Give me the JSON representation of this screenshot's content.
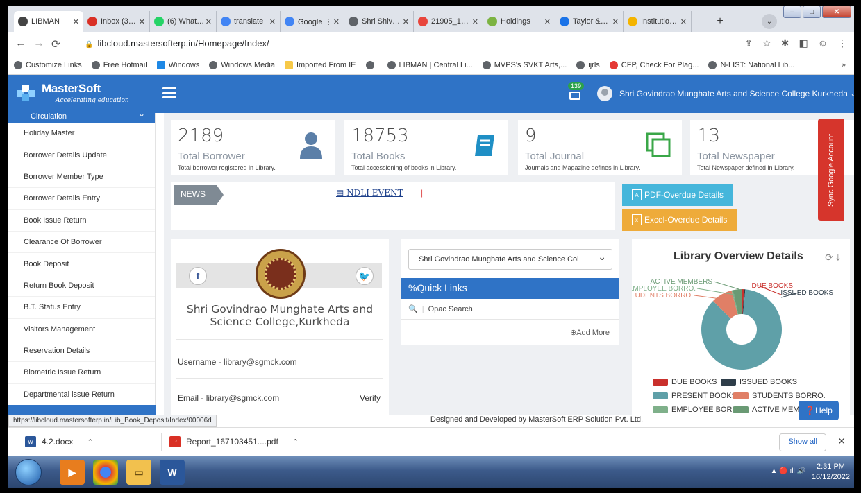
{
  "browser": {
    "tabs": [
      {
        "label": "LIBMAN",
        "color": "#444444",
        "active": true
      },
      {
        "label": "Inbox (3…",
        "color": "#d93025"
      },
      {
        "label": "(6) What…",
        "color": "#25d366"
      },
      {
        "label": "translate",
        "color": "#4285f4"
      },
      {
        "label": "Google ⋮",
        "color": "#4285f4"
      },
      {
        "label": "Shri Shiv…",
        "color": "#5f6368"
      },
      {
        "label": "21905_1…",
        "color": "#e8453c"
      },
      {
        "label": "Holdings",
        "color": "#7cb342"
      },
      {
        "label": "Taylor &…",
        "color": "#1a73e8"
      },
      {
        "label": "Institutio…",
        "color": "#f4b400"
      }
    ],
    "url": "libcloud.mastersofterp.in/Homepage/Index/",
    "bookmarks": [
      {
        "label": "Customize Links",
        "type": "globe"
      },
      {
        "label": "Free Hotmail",
        "type": "globe"
      },
      {
        "label": "Windows",
        "type": "win"
      },
      {
        "label": "Windows Media",
        "type": "globe"
      },
      {
        "label": "Imported From IE",
        "type": "folder"
      },
      {
        "label": "",
        "type": "globe"
      },
      {
        "label": "LIBMAN | Central Li...",
        "type": "globe"
      },
      {
        "label": "MVPS's SVKT Arts,...",
        "type": "globe"
      },
      {
        "label": "ijrls",
        "type": "globe"
      },
      {
        "label": "CFP, Check For Plag...",
        "type": "check"
      },
      {
        "label": "N-LIST: National Lib...",
        "type": "globe"
      }
    ],
    "bookmarks_more": "»",
    "status_url": "https://libcloud.mastersofterp.in/Lib_Book_Deposit/Index/00006d"
  },
  "app": {
    "logo_name": "MasterSoft",
    "logo_tag": "Accelerating education",
    "notif_count": "139",
    "user_name": "Shri Govindrao Munghate Arts and Science College Kurkheda ⌄",
    "sidebar_section": "Circulation",
    "sidebar": [
      "Holiday Master",
      "Borrower Details Update",
      "Borrower Member Type",
      "Borrower Details Entry",
      "Book Issue Return",
      "Clearance Of Borrower",
      "Book Deposit",
      "Return Book Deposit",
      "B.T. Status Entry",
      "Visitors Management",
      "Reservation Details",
      "Biometric Issue Return",
      "Departmental issue Return"
    ],
    "stats": [
      {
        "num": "2189",
        "label": "Total Borrower",
        "sub": "Total borrower registered in Library.",
        "icon": "user-icon",
        "color": "#5b7fa8"
      },
      {
        "num": "18753",
        "label": "Total Books",
        "sub": "Total accessioning of books in Library.",
        "icon": "book-icon",
        "color": "#1f8fc5"
      },
      {
        "num": "9",
        "label": "Total Journal",
        "sub": "Journals and Magazine defines in Library.",
        "icon": "journal-icon",
        "color": "#3aa748"
      },
      {
        "num": "13",
        "label": "Total Newspaper",
        "sub": "Total Newspaper defined in Library.",
        "icon": "newspaper-icon",
        "color": "#e86b4a"
      }
    ],
    "news_label": "NEWS",
    "news_event": "NDLI EVENT",
    "news_sep": "|",
    "pdf_btn": "PDF-Overdue Details",
    "excel_btn": "Excel-Overdue Details",
    "college_name": "Shri Govindrao Munghate Arts and Science College,Kurkheda",
    "username_label": "Username",
    "username_value": "library@sgmck.com",
    "email_label": "Email",
    "email_value": "library@sgmck.com",
    "verify": "Verify",
    "college_select": "Shri Govindrao Munghate Arts and Science Col",
    "quick_links": "Quick Links",
    "opac": "Opac Search",
    "add_more": "Add More",
    "overview_title": "Library Overview Details",
    "sync_google": "Sync Google Account",
    "help": "Help",
    "footer": "Designed and Developed by MasterSoft ERP Solution Pvt. Ltd."
  },
  "chart_data": {
    "type": "pie",
    "title": "Library Overview Details",
    "labels": [
      "DUE BOOKS",
      "ISSUED BOOKS",
      "PRESENT BOOKS",
      "STUDENTS BORRO.",
      "EMPLOYEE BORRO.",
      "ACTIVE MEMBERS"
    ],
    "values": [
      1.0,
      0.5,
      86.0,
      8.5,
      0.5,
      3.5
    ],
    "colors": [
      "#c9302c",
      "#2e3d49",
      "#5fa0a8",
      "#e07f66",
      "#7fb08a",
      "#6a9a74"
    ],
    "donut": true,
    "legend": "bottom"
  },
  "downloads": [
    {
      "name": "4.2.docx",
      "color": "#2b579a"
    },
    {
      "name": "Report_167103451....pdf",
      "color": "#d93025"
    }
  ],
  "show_all": "Show all",
  "taskbar": {
    "time": "2:31 PM",
    "date": "16/12/2022"
  }
}
